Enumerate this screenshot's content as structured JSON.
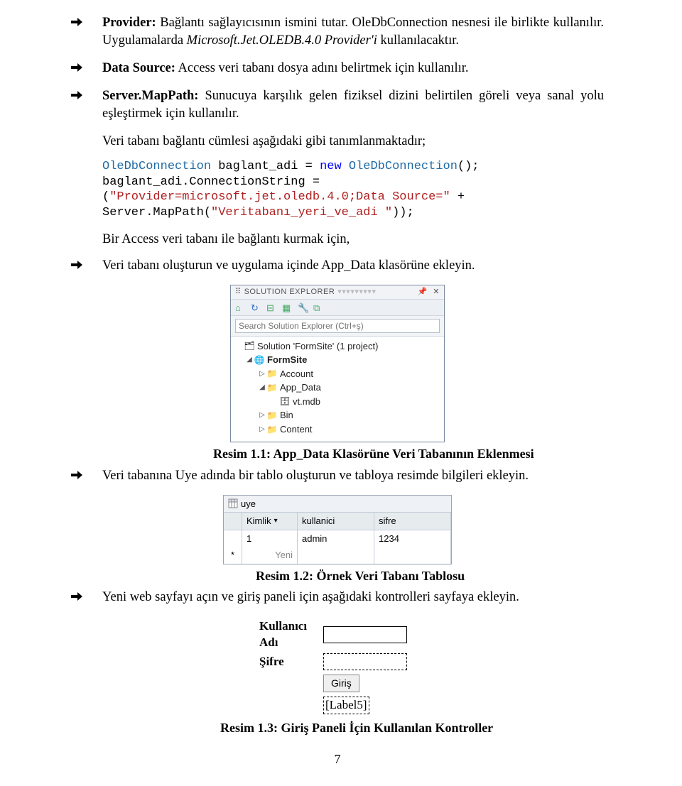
{
  "bullets": {
    "provider_pre": "Provider:",
    "provider_text": " Bağlantı sağlayıcısının ismini tutar. OleDbConnection nesnesi ile birlikte kullanılır. Uygulamalarda ",
    "provider_mid": "Microsoft.Jet.OLEDB.4.0 Provider'i",
    "provider_post": " kullanılacaktır.",
    "datasource_pre": "Data Source:",
    "datasource_text": " Access veri tabanı dosya adını belirtmek için kullanılır.",
    "mappath_pre": "Server.MapPath:",
    "mappath_text": " Sunucuya karşılık gelen fiziksel dizini belirtilen göreli veya sanal yolu eşleştirmek için kullanılır.",
    "appdata_step": "Veri tabanı oluşturun ve uygulama içinde App_Data klasörüne ekleyin.",
    "uye_step": "Veri tabanına Uye adında bir tablo oluşturun ve tabloya resimde bilgileri ekleyin.",
    "web_step": "Yeni web sayfayı açın ve giriş paneli için aşağıdaki kontrolleri sayfaya ekleyin."
  },
  "para1": "Veri tabanı bağlantı cümlesi aşağıdaki gibi tanımlanmaktadır;",
  "code": {
    "t1a": "OleDbConnection",
    "t1b": " baglant_adi = ",
    "t1c": "new",
    "t1d": " ",
    "t1e": "OleDbConnection",
    "t1f": "();",
    "t2a": "baglant_adi.ConnectionString = (",
    "t2b": "\"Provider=microsoft.jet.oledb.4.0;Data Source=\"",
    "t2c": " + Server.MapPath(",
    "t2d": "\"Veritabanı_yeri_ve_adi \"",
    "t2e": "));"
  },
  "para2": "Bir Access veri tabanı ile bağlantı kurmak için,",
  "solexp": {
    "title": "SOLUTION EXPLORER",
    "search_ph": "Search Solution Explorer (Ctrl+ş)",
    "sol": "Solution 'FormSite' (1 project)",
    "proj": "FormSite",
    "items": [
      "Account",
      "App_Data",
      "vt.mdb",
      "Bin",
      "Content"
    ]
  },
  "caption1_b": "Resim 1.1: App_Data Klasörüne Veri Tabanının Eklenmesi",
  "uye": {
    "tab": "uye",
    "h1": "Kimlik",
    "h2": "kullanici",
    "h3": "sifre",
    "r1c1": "1",
    "r1c2": "admin",
    "r1c3": "1234",
    "r2": "Yeni"
  },
  "caption2_b": "Resim 1.2: Örnek Veri Tabanı Tablosu",
  "login": {
    "l1": "Kullanıcı",
    "l1b": "Adı",
    "l2": "Şifre",
    "btn": "Giriş",
    "lbl5": "[Label5]"
  },
  "caption3_b": "Resim 1.3: Giriş Paneli İçin Kullanılan Kontroller",
  "pagenum": "7"
}
